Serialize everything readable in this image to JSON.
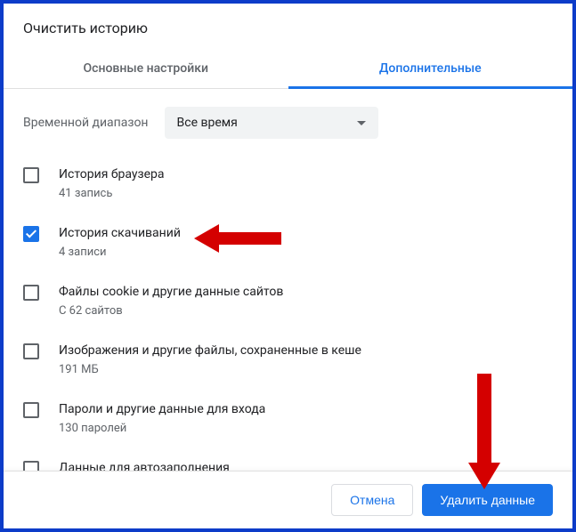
{
  "dialog": {
    "title": "Очистить историю",
    "tabs": {
      "basic": "Основные настройки",
      "advanced": "Дополнительные"
    },
    "time_range": {
      "label": "Временной диапазон",
      "selected": "Все время"
    },
    "options": [
      {
        "title": "История браузера",
        "sub": "41 запись",
        "checked": false
      },
      {
        "title": "История скачиваний",
        "sub": "4 записи",
        "checked": true
      },
      {
        "title": "Файлы cookie и другие данные сайтов",
        "sub": "С 62 сайтов",
        "checked": false
      },
      {
        "title": "Изображения и другие файлы, сохраненные в кеше",
        "sub": "191 МБ",
        "checked": false
      },
      {
        "title": "Пароли и другие данные для входа",
        "sub": "130 паролей",
        "checked": false
      },
      {
        "title": "Данные для автозаполнения",
        "sub": "",
        "checked": false
      }
    ],
    "buttons": {
      "cancel": "Отмена",
      "delete": "Удалить данные"
    }
  }
}
